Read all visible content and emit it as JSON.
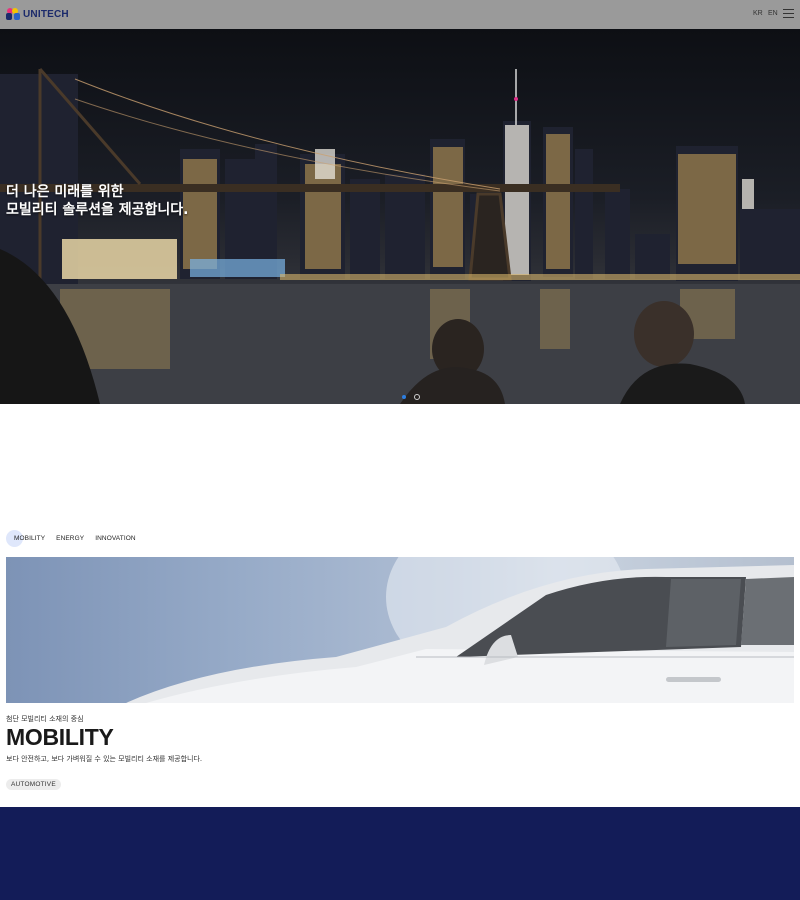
{
  "header": {
    "logo_text": "UNITECH",
    "lang_kr": "KR",
    "lang_en": "EN",
    "menu_icon": "hamburger-menu-icon"
  },
  "hero": {
    "title_line1": "더 나은 미래를 위한",
    "title_line2": "모빌리티 솔루션을 제공합니다.",
    "slides_total": 2,
    "slide_active": 1
  },
  "tabs": [
    {
      "label": "MOBILITY",
      "active": true
    },
    {
      "label": "ENERGY",
      "active": false
    },
    {
      "label": "INNOVATION",
      "active": false
    }
  ],
  "section": {
    "subtitle": "첨단 모빌리티 소재의 중심",
    "title": "MOBILITY",
    "description": "보다 안전하고, 보다 가벼워질 수 있는 모빌리티 소재를 제공합니다.",
    "chip": "AUTOMOTIVE"
  },
  "colors": {
    "header_bg": "#9a9a9a",
    "brand_navy": "#131c58",
    "accent_blue": "#2d7ee0",
    "active_tab_bg": "#dfe7fb"
  }
}
